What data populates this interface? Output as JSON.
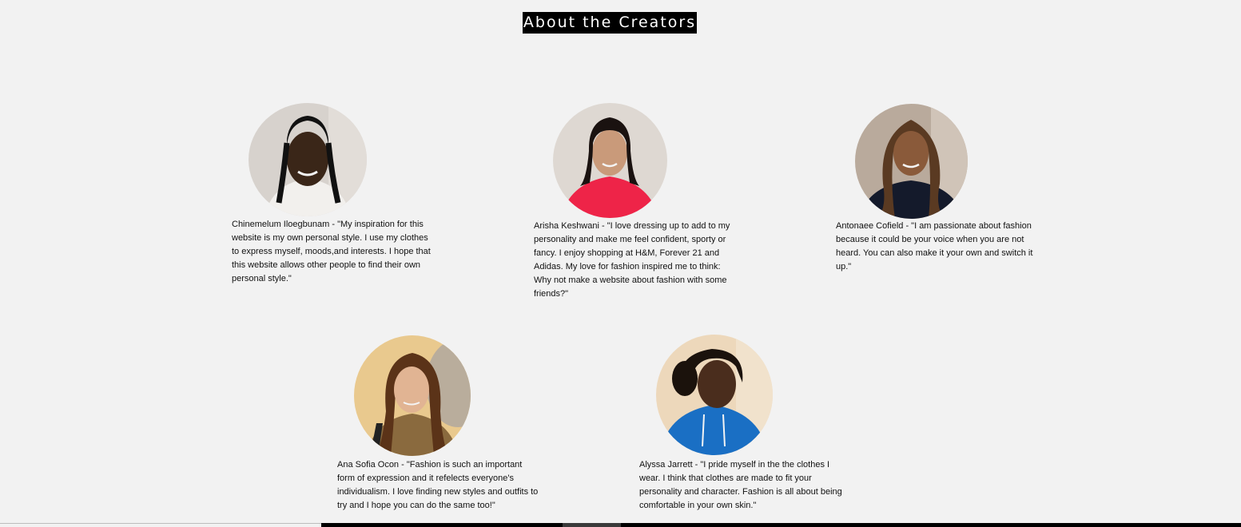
{
  "page": {
    "title": "About the Creators"
  },
  "creators": [
    {
      "portrait_alt": "portrait",
      "bio": "Chinemelum Iloegbunam - \"My inspiration for this website is my own personal style. I use my clothes to express myself, moods,and interests. I hope that this website allows other people to find their own personal style.\""
    },
    {
      "portrait_alt": "portrait",
      "bio": "Arisha Keshwani - \"I love dressing up to add to my personality and make me feel confident, sporty or fancy. I enjoy shopping at H&M, Forever 21 and Adidas. My love for fashion inspired me to think: Why not make a website about fashion with some friends?\""
    },
    {
      "portrait_alt": "portrait",
      "bio": "Antonaee Cofield - \"I am passionate about fashion because it could be your voice when you are not heard. You can also make it your own and switch it up.\""
    },
    {
      "portrait_alt": "portrait",
      "bio": "Ana Sofia Ocon - \"Fashion is such an important form of expression and it refelects everyone's individualism. I love finding new styles and outfits to try and I hope you can do the same too!\""
    },
    {
      "portrait_alt": "portrait",
      "bio": "Alyssa Jarrett - \"I pride myself in the the clothes I wear. I think that clothes are made to fit your personality and character. Fashion is all about being comfortable in your own skin.\""
    }
  ],
  "colors": {
    "background": "#f2f2f2",
    "title_bg": "#000000",
    "title_text": "#ffffff",
    "bio_text": "#111111"
  }
}
